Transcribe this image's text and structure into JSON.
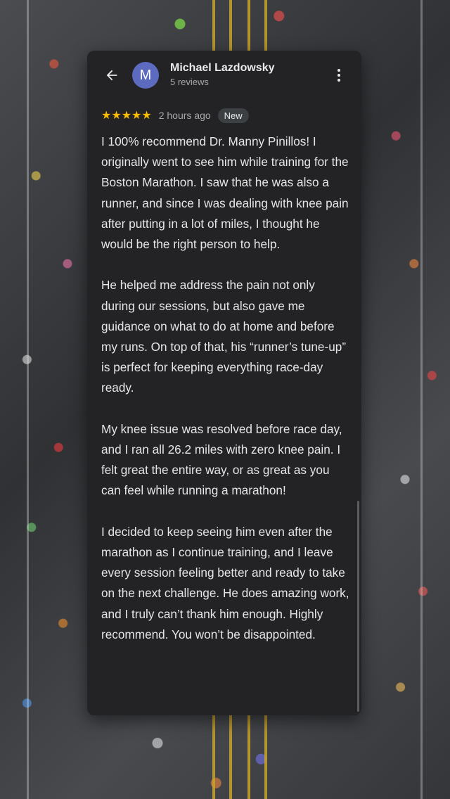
{
  "reviewer": {
    "initial": "M",
    "name": "Michael Lazdowsky",
    "meta": "5 reviews",
    "avatar_color": "#5c6bc0"
  },
  "review": {
    "stars": "★★★★★",
    "rating": 5,
    "time_ago": "2 hours ago",
    "badge": "New",
    "star_color": "#fbbc04",
    "paragraphs": [
      "I 100% recommend Dr. Manny Pinillos! I originally went to see him while training for the Boston Marathon. I saw that he was also a runner, and since I was dealing with knee pain after putting in a lot of miles, I thought he would be the right person to help.",
      "He helped me address the pain not only during our sessions, but also gave me guidance on what to do at home and before my runs. On top of that, his “runner’s tune-up” is perfect for keeping everything race-day ready.",
      "My knee issue was resolved before race day, and I ran all 26.2 miles with zero knee pain. I felt great the entire way, or as great as you can feel while running a marathon!",
      "I decided to keep seeing him even after the marathon as I continue training, and I leave every session feeling better and ready to take on the next challenge. He does amazing work, and I truly can’t thank him enough. Highly recommend. You won’t be disappointed."
    ]
  },
  "icons": {
    "back": "back-arrow-icon",
    "more": "more-vert-icon"
  },
  "colors": {
    "card_background": "#232225",
    "text": "#e6e6e6"
  }
}
